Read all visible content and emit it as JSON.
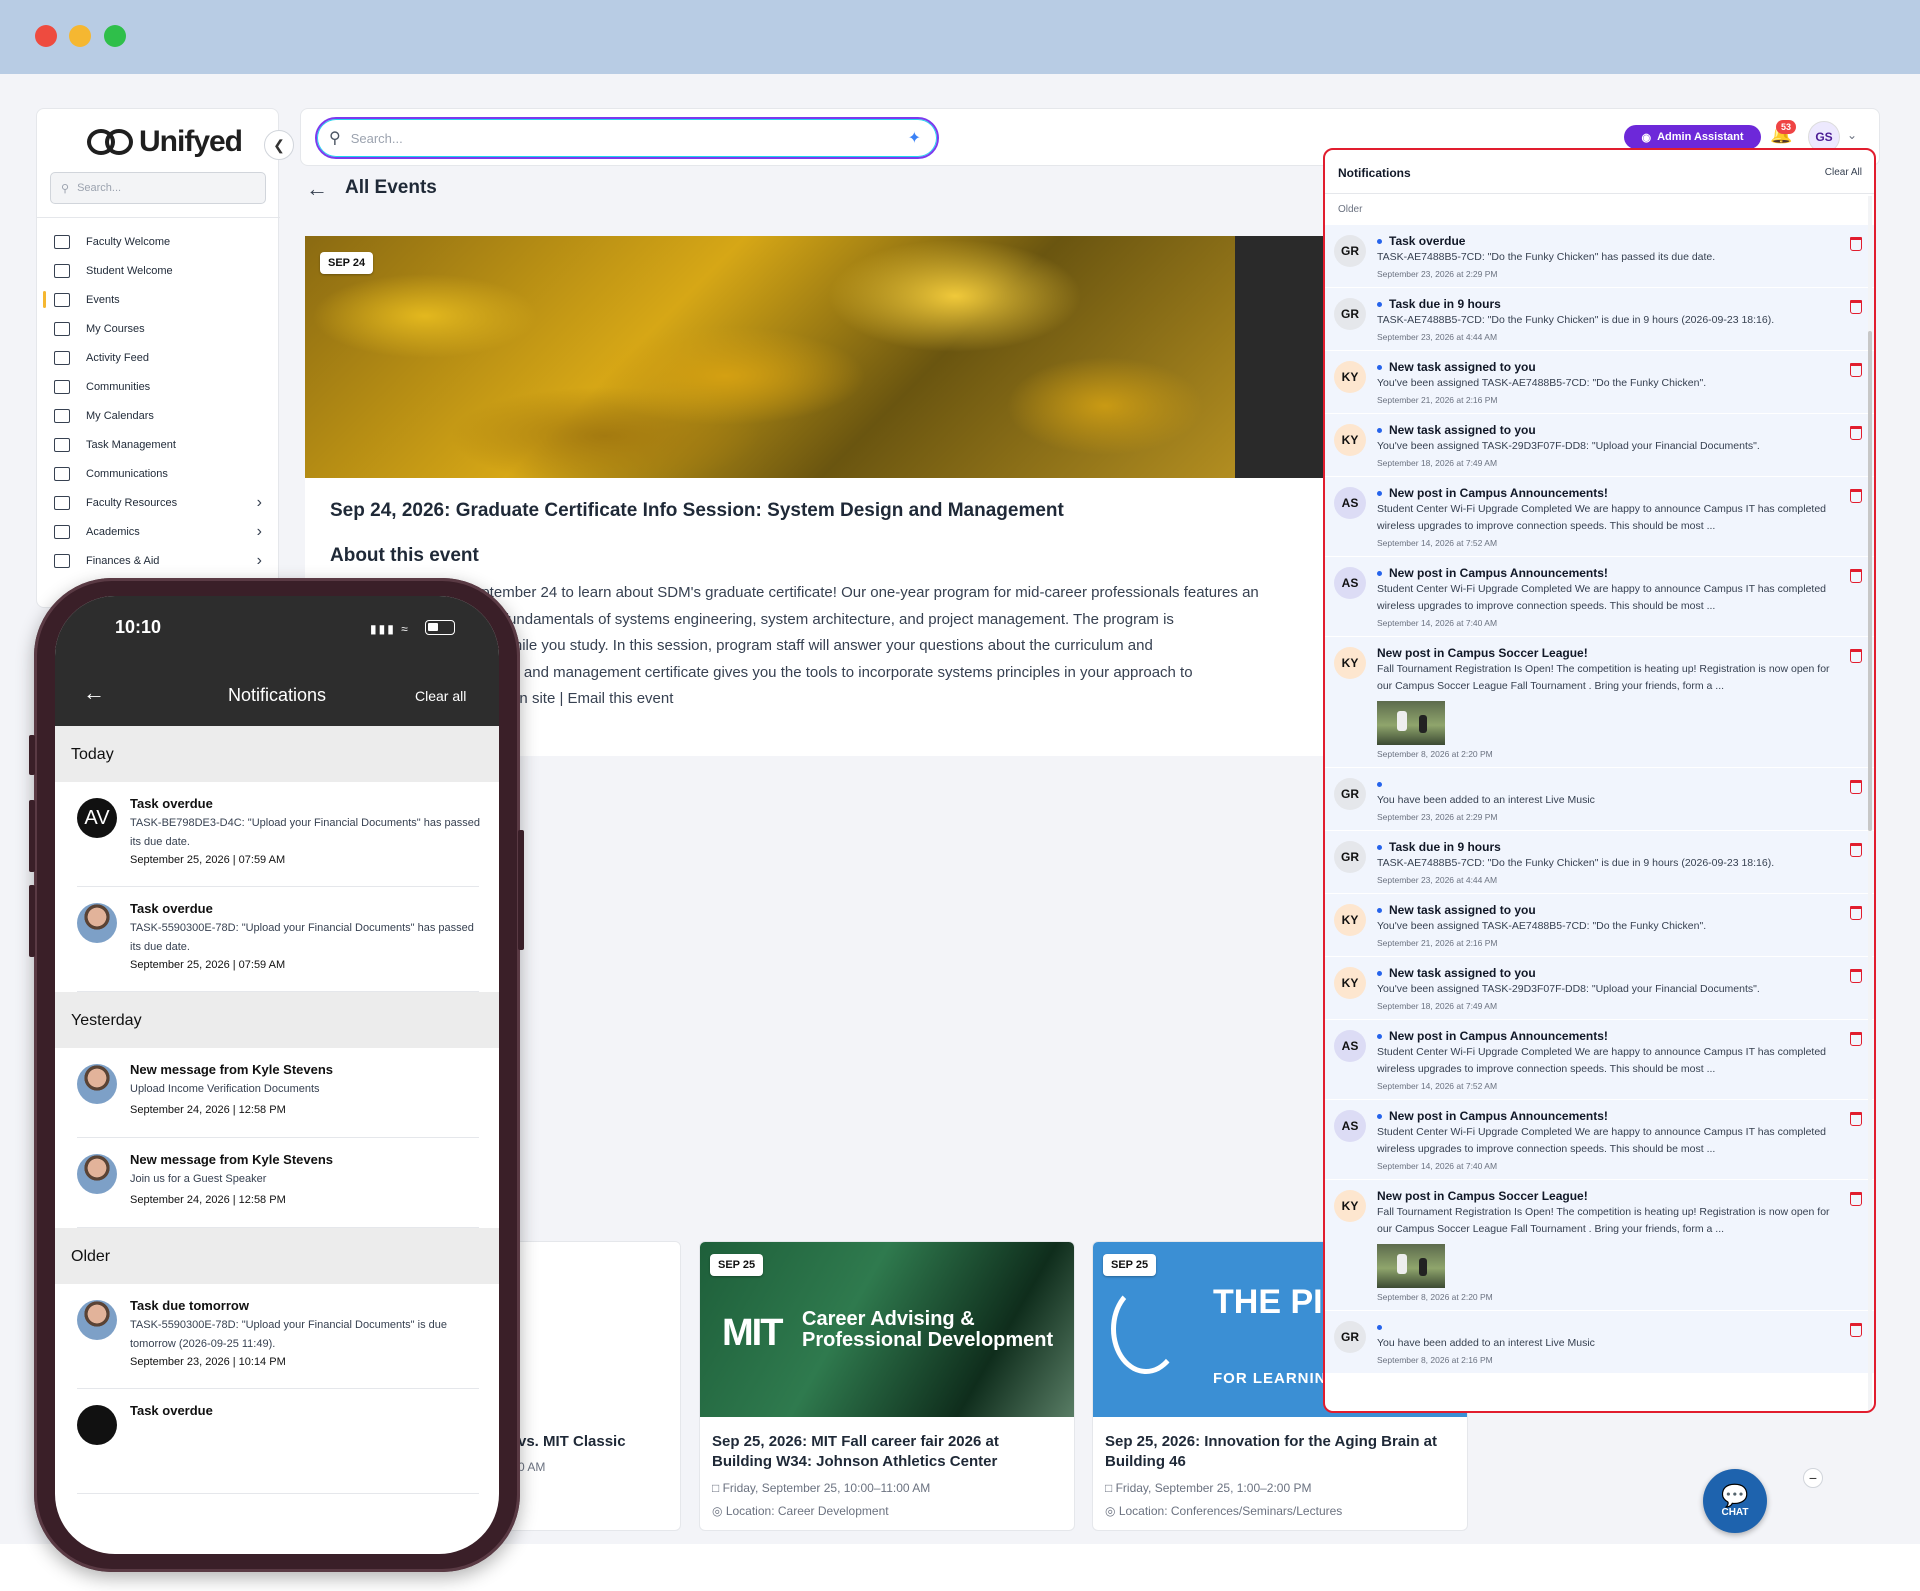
{
  "window": {
    "controls": [
      "close",
      "minimize",
      "maximize"
    ]
  },
  "brand": {
    "logo_text": "Unifyed"
  },
  "sidebar": {
    "search_placeholder": "Search...",
    "items": [
      {
        "label": "Faculty Welcome",
        "icon": "layout-icon",
        "chevron": false
      },
      {
        "label": "Student Welcome",
        "icon": "home-icon",
        "chevron": false
      },
      {
        "label": "Events",
        "icon": "calendar-check-icon",
        "chevron": false,
        "active": true
      },
      {
        "label": "My Courses",
        "icon": "courses-icon",
        "chevron": false
      },
      {
        "label": "Activity Feed",
        "icon": "feed-icon",
        "chevron": false
      },
      {
        "label": "Communities",
        "icon": "people-icon",
        "chevron": false
      },
      {
        "label": "My Calendars",
        "icon": "calendar-icon",
        "chevron": false
      },
      {
        "label": "Task Management",
        "icon": "task-icon",
        "chevron": false
      },
      {
        "label": "Communications",
        "icon": "megaphone-icon",
        "chevron": false
      },
      {
        "label": "Faculty Resources",
        "icon": "resources-icon",
        "chevron": true
      },
      {
        "label": "Academics",
        "icon": "academics-icon",
        "chevron": true
      },
      {
        "label": "Finances & Aid",
        "icon": "dollar-icon",
        "chevron": true
      }
    ]
  },
  "topbar": {
    "search_placeholder": "Search...",
    "admin_button": "Admin Assistant",
    "notification_count": "53",
    "user_initials": "GS"
  },
  "page": {
    "title": "All Events",
    "hero_date": "SEP 24",
    "event_title": "Sep 24, 2026: Graduate Certificate Info Session: System Design and Management",
    "about_heading": "About this event",
    "about_lines": [
      "eptember 24 to learn about SDM's graduate certificate! Our one-year program for mid-career professionals features an",
      "on the fundamentals of systems engineering, system architecture, and project management. The program is",
      "orking while you study. In this session, program staff will answer your questions about the curriculum and",
      "gineering and management certificate gives you the tools to incorporate systems principles in your approach to",
      "n. View on site | Email this event"
    ]
  },
  "related_events": [
    {
      "title": "vs. MIT Classic",
      "meta_time": "0 AM"
    },
    {
      "date": "SEP 25",
      "image_text": "Career Advising & Professional Development",
      "logo": "MIT",
      "title": "Sep 25, 2026: MIT Fall career fair 2026 at Building W34: Johnson Athletics Center",
      "meta_time": "Friday, September 25, 10:00–11:00 AM",
      "meta_location": "Location: Career Development"
    },
    {
      "date": "SEP 25",
      "image_text": "THE PI INSTIT",
      "image_sub": "FOR LEARNIN",
      "title": "Sep 25, 2026: Innovation for the Aging Brain at Building 46",
      "meta_time": "Friday, September 25, 1:00–2:00 PM",
      "meta_location": "Location: Conferences/Seminars/Lectures"
    }
  ],
  "chat": {
    "label": "CHAT",
    "minimize": "−"
  },
  "notifications_panel": {
    "title": "Notifications",
    "clear_all": "Clear All",
    "section": "Older",
    "items": [
      {
        "initials": "GR",
        "title": "Task overdue",
        "body": "TASK-AE7488B5-7CD: \"Do the Funky Chicken\" has passed its due date.",
        "time": "September 23, 2026 at 2:29 PM",
        "dot": true
      },
      {
        "initials": "GR",
        "title": "Task due in 9 hours",
        "body": "TASK-AE7488B5-7CD: \"Do the Funky Chicken\" is due in 9 hours (2026-09-23 18:16).",
        "time": "September 23, 2026 at 4:44 AM",
        "dot": true
      },
      {
        "initials": "KY",
        "title": "New task assigned to you",
        "body": "You've been assigned TASK-AE7488B5-7CD: \"Do the Funky Chicken\".",
        "time": "September 21, 2026 at 2:16 PM",
        "dot": true
      },
      {
        "initials": "KY",
        "title": "New task assigned to you",
        "body": "You've been assigned TASK-29D3F07F-DD8: \"Upload your Financial Documents\".",
        "time": "September 18, 2026 at 7:49 AM",
        "dot": true
      },
      {
        "initials": "AS",
        "title": "New post in Campus Announcements!",
        "body": "Student Center Wi-Fi Upgrade Completed We are happy to announce Campus IT has completed wireless upgrades to improve connection speeds. This should be most ...",
        "time": "September 14, 2026 at 7:52 AM",
        "dot": true
      },
      {
        "initials": "AS",
        "title": "New post in Campus Announcements!",
        "body": "Student Center Wi-Fi Upgrade Completed We are happy to announce Campus IT has completed wireless upgrades to improve connection speeds. This should be most ...",
        "time": "September 14, 2026 at 7:40 AM",
        "dot": true
      },
      {
        "initials": "KY",
        "title": "New post in Campus Soccer League!",
        "body": "Fall Tournament Registration Is Open! The competition is heating up! Registration is now open for our Campus Soccer League Fall Tournament . Bring your friends, form a ...",
        "time": "September 8, 2026 at 2:20 PM",
        "dot": false,
        "thumb": true
      },
      {
        "initials": "GR",
        "title": "",
        "body": "You have been added to an interest Live Music",
        "time": "September 23, 2026 at 2:29 PM",
        "dot": true
      },
      {
        "initials": "GR",
        "title": "Task due in 9 hours",
        "body": "TASK-AE7488B5-7CD: \"Do the Funky Chicken\" is due in 9 hours (2026-09-23 18:16).",
        "time": "September 23, 2026 at 4:44 AM",
        "dot": true
      },
      {
        "initials": "KY",
        "title": "New task assigned to you",
        "body": "You've been assigned TASK-AE7488B5-7CD: \"Do the Funky Chicken\".",
        "time": "September 21, 2026 at 2:16 PM",
        "dot": true
      },
      {
        "initials": "KY",
        "title": "New task assigned to you",
        "body": "You've been assigned TASK-29D3F07F-DD8: \"Upload your Financial Documents\".",
        "time": "September 18, 2026 at 7:49 AM",
        "dot": true
      },
      {
        "initials": "AS",
        "title": "New post in Campus Announcements!",
        "body": "Student Center Wi-Fi Upgrade Completed We are happy to announce Campus IT has completed wireless upgrades to improve connection speeds. This should be most ...",
        "time": "September 14, 2026 at 7:52 AM",
        "dot": true
      },
      {
        "initials": "AS",
        "title": "New post in Campus Announcements!",
        "body": "Student Center Wi-Fi Upgrade Completed We are happy to announce Campus IT has completed wireless upgrades to improve connection speeds. This should be most ...",
        "time": "September 14, 2026 at 7:40 AM",
        "dot": true
      },
      {
        "initials": "KY",
        "title": "New post in Campus Soccer League!",
        "body": "Fall Tournament Registration Is Open! The competition is heating up! Registration is now open for our Campus Soccer League Fall Tournament . Bring your friends, form a ...",
        "time": "September 8, 2026 at 2:20 PM",
        "dot": false,
        "thumb": true
      },
      {
        "initials": "GR",
        "title": "",
        "body": "You have been added to an interest Live Music",
        "time": "September 8, 2026 at 2:16 PM",
        "dot": true
      }
    ]
  },
  "phone": {
    "time": "10:10",
    "title": "Notifications",
    "clear_all": "Clear all",
    "sections": [
      {
        "label": "Today",
        "items": [
          {
            "avatar": "AV",
            "title": "Task overdue",
            "body": "TASK-BE798DE3-D4C: \"Upload your Financial Documents\" has passed its due date.",
            "time": "September 25, 2026 | 07:59 AM"
          },
          {
            "avatar": "photo",
            "title": "Task overdue",
            "body": "TASK-5590300E-78D: \"Upload your Financial Documents\" has passed its due date.",
            "time": "September 25, 2026 | 07:59 AM"
          }
        ]
      },
      {
        "label": "Yesterday",
        "items": [
          {
            "avatar": "photo",
            "title": "New message from Kyle Stevens",
            "body": "Upload Income Verification Documents",
            "time": "September 24, 2026 | 12:58 PM"
          },
          {
            "avatar": "photo",
            "title": "New message from Kyle Stevens",
            "body": "Join us for a Guest Speaker",
            "time": "September 24, 2026 | 12:58 PM"
          }
        ]
      },
      {
        "label": "Older",
        "items": [
          {
            "avatar": "photo",
            "title": "Task due tomorrow",
            "body": "TASK-5590300E-78D: \"Upload your Financial Documents\" is due tomorrow (2026-09-25 11:49).",
            "time": "September 23, 2026 | 10:14 PM"
          },
          {
            "avatar": "avatar-black",
            "title": "Task overdue",
            "body": "",
            "time": ""
          }
        ]
      }
    ]
  },
  "colors": {
    "accent_purple": "#6d28d9",
    "alert_red": "#e11d2e",
    "unread_dot": "#2563eb",
    "chat_blue": "#1e63ae"
  }
}
